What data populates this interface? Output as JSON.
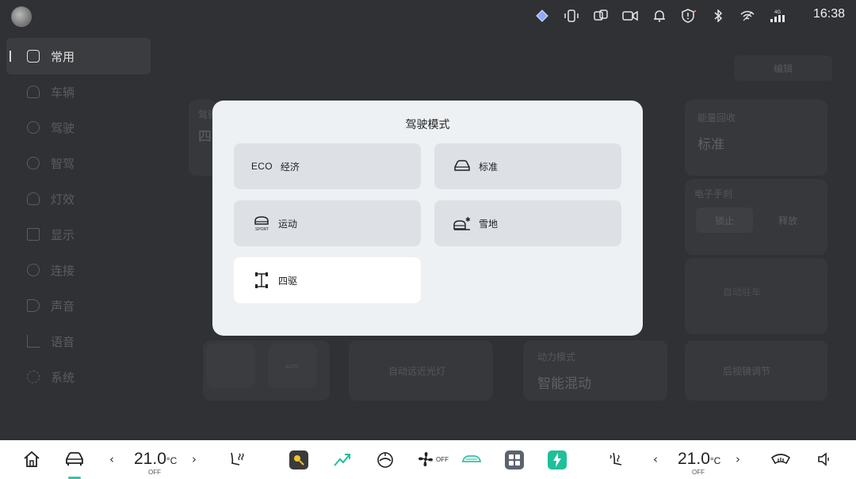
{
  "status": {
    "time": "16:38",
    "icons": [
      "assistant-icon",
      "phone-key-icon",
      "screen-mirror-icon",
      "camera-icon",
      "bell-icon",
      "shield-icon",
      "bluetooth-icon",
      "wifi-icon",
      "signal-4g-icon"
    ],
    "signal_label": "4G"
  },
  "sidebar": {
    "items": [
      {
        "label": "常用",
        "icon": "cube-icon",
        "active": true
      },
      {
        "label": "车辆",
        "icon": "car-icon"
      },
      {
        "label": "驾驶",
        "icon": "steering-icon"
      },
      {
        "label": "智驾",
        "icon": "smart-drive-icon"
      },
      {
        "label": "灯效",
        "icon": "light-icon"
      },
      {
        "label": "显示",
        "icon": "display-icon"
      },
      {
        "label": "连接",
        "icon": "link-icon"
      },
      {
        "label": "声音",
        "icon": "speaker-icon"
      },
      {
        "label": "语音",
        "icon": "voice-icon"
      },
      {
        "label": "系统",
        "icon": "gear-icon"
      }
    ]
  },
  "background": {
    "edit_label": "编辑",
    "drive_label": "驾驶",
    "drive_value": "四",
    "energy_label": "能量回收",
    "energy_value": "标准",
    "parking_label": "电子手刹",
    "lock_label": "锁止",
    "release_label": "释放",
    "auto_park": "自动驻车",
    "auto_light": "自动远近光灯",
    "power_label": "动力模式",
    "power_value": "智能混动",
    "mirror_label": "后视镜调节",
    "auto_tag": "AUTO"
  },
  "modal": {
    "title": "驾驶模式",
    "options": [
      {
        "prefix": "ECO",
        "label": "经济",
        "icon": ""
      },
      {
        "prefix": "",
        "label": "标准",
        "icon": "car-outline-icon"
      },
      {
        "prefix": "",
        "label": "运动",
        "icon": "sport-car-icon",
        "tag": "SPORT"
      },
      {
        "prefix": "",
        "label": "雪地",
        "icon": "snow-car-icon"
      },
      {
        "prefix": "",
        "label": "四驱",
        "icon": "awd-icon",
        "selected": true
      }
    ]
  },
  "dock": {
    "left_temp": "21.0",
    "right_temp": "21.0",
    "temp_unit": "°C",
    "off_label": "OFF",
    "fan_off": "OFF",
    "colors": {
      "accent": "#39c0a8",
      "app_yellow": "#f1c232",
      "app_green": "#1fbf9a"
    }
  }
}
